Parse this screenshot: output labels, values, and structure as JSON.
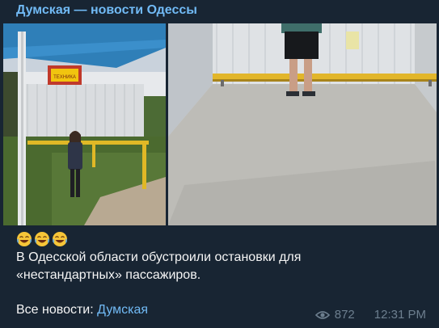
{
  "channel": {
    "name": "Думская — новости Одессы"
  },
  "post": {
    "emojis": [
      "laughing-face",
      "laughing-face",
      "laughing-face"
    ],
    "text_line1": "В Одесской области обустроили остановки для",
    "text_line2": "«нестандартных» пассажиров.",
    "footer_prefix": "Все новости: ",
    "footer_link": "Думская"
  },
  "meta": {
    "views": "872",
    "time": "12:31 PM"
  },
  "colors": {
    "accent": "#71baf5",
    "bubble": "#182533",
    "muted": "#6d7f8f"
  },
  "photo1": {
    "sign_text": "ТЕХНИКА"
  }
}
